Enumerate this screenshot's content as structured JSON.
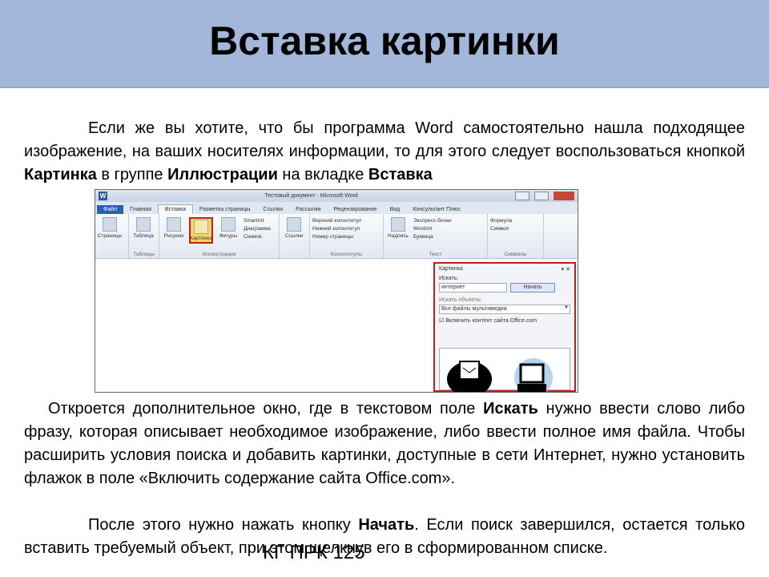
{
  "title": "Вставка картинки",
  "paragraph1": {
    "t1": "Если же вы хотите, что бы программа Word самостоятельно нашла подходящее изображение, на ваших носителях информации, то для этого следует воспользоваться кнопкой ",
    "b1": "Картинка",
    "t2": " в группе ",
    "b2": "Иллюстрации",
    "t3": " на вкладке ",
    "b3": "Вставка"
  },
  "paragraph2": {
    "t1": "Откроется дополнительное окно, где в текстовом поле ",
    "b1": "Искать",
    "t2": " нужно ввести слово либо фразу, которая описывает необходимое изображение, либо ввести полное имя файла. Чтобы расширить условия поиска и добавить картинки, доступные в сети Интернет, нужно установить флажок в поле «Включить содержание сайта Office.com»."
  },
  "paragraph3": {
    "t1": "После этого нужно нажать кнопку ",
    "b1": "Начать",
    "t2": ". Если поиск завершился, остается только вставить требуемый объект, при этом щелкнув его в сформированном списке."
  },
  "footer": "КГ ПРК 125",
  "word": {
    "window_title": "Тестовый документ - Microsoft Word",
    "tabs": [
      "Файл",
      "Главная",
      "Вставка",
      "Разметка страницы",
      "Ссылки",
      "Рассылки",
      "Рецензирование",
      "Вид",
      "Консультант Плюс"
    ],
    "active_tab": "Вставка",
    "groups": {
      "pages": {
        "label": "",
        "items": [
          "Страницы"
        ]
      },
      "tables": {
        "label": "Таблицы",
        "items": [
          "Таблица"
        ]
      },
      "illustrations": {
        "label": "Иллюстрации",
        "items": [
          "Рисунок",
          "Картинка",
          "Фигуры"
        ],
        "small": [
          "SmartArt",
          "Диаграмма",
          "Снимок"
        ]
      },
      "links": {
        "label": "",
        "items": [
          "Ссылки"
        ]
      },
      "headers": {
        "label": "Колонтитулы",
        "small": [
          "Верхний колонтитул",
          "Нижний колонтитул",
          "Номер страницы"
        ]
      },
      "text": {
        "label": "Текст",
        "items": [
          "Надпись"
        ],
        "small": [
          "Экспресс-блоки",
          "WordArt",
          "Буквица"
        ]
      },
      "symbols": {
        "label": "Символы",
        "small": [
          "Формула",
          "Символ"
        ]
      }
    },
    "pane": {
      "title": "Картинка",
      "search_label": "Искать:",
      "search_value": "интернет",
      "go_button": "Начать",
      "type_label": "Искать объекты:",
      "type_value": "Все файлы мультимедиа",
      "checkbox_label": "Включить контент сайта Office.com",
      "checkbox_checked": true
    },
    "highlight_color": "#c0201a"
  },
  "colors": {
    "header_band": "#a3b7db"
  }
}
